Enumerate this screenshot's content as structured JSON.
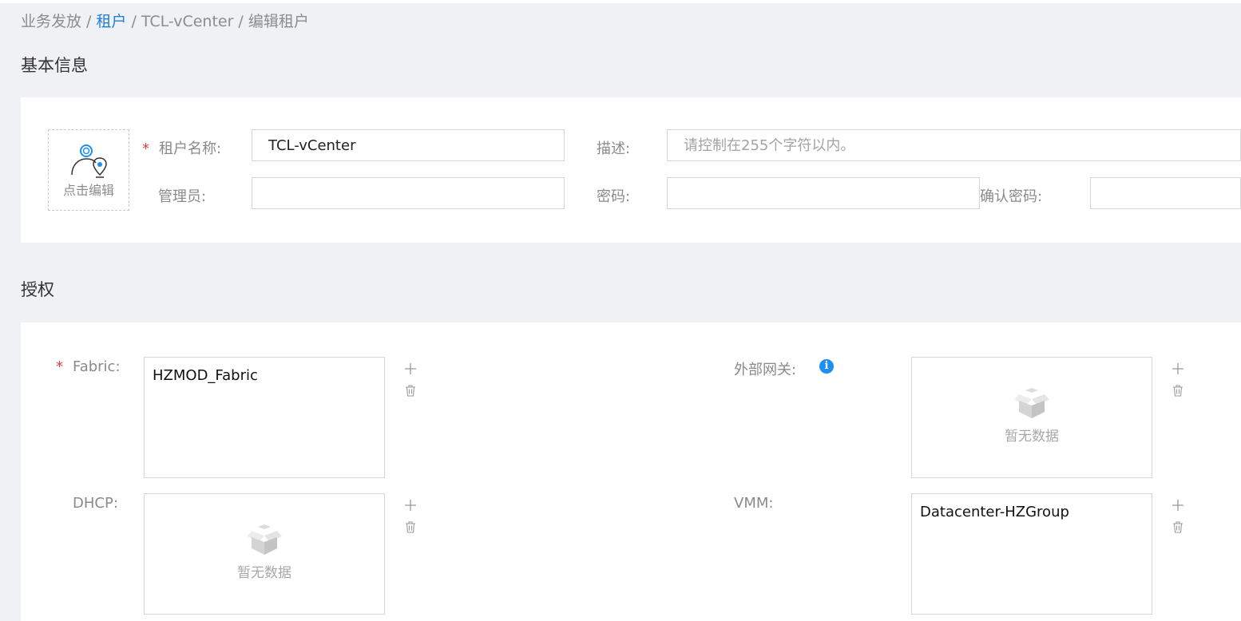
{
  "breadcrumb": {
    "items": [
      "业务发放",
      "租户",
      "TCL-vCenter",
      "编辑租户"
    ],
    "separator": "/"
  },
  "basic_info": {
    "title": "基本信息",
    "avatar_caption": "点击编辑",
    "tenant_name_label": "租户名称:",
    "tenant_name_value": "TCL-vCenter",
    "description_label": "描述:",
    "description_placeholder": "请控制在255个字符以内。",
    "admin_label": "管理员:",
    "admin_value": "",
    "password_label": "密码:",
    "password_value": "",
    "confirm_password_label": "确认密码:",
    "confirm_password_value": "",
    "required_mark": "*"
  },
  "authorization": {
    "title": "授权",
    "fabric": {
      "label": "Fabric:",
      "items": [
        "HZMOD_Fabric"
      ]
    },
    "external_gateway": {
      "label": "外部网关:",
      "empty_text": "暂无数据"
    },
    "dhcp": {
      "label": "DHCP:",
      "empty_text": "暂无数据"
    },
    "vmm": {
      "label": "VMM:",
      "items": [
        "Datacenter-HZGroup"
      ]
    }
  },
  "colors": {
    "page_bg": "#f0f1f4",
    "card_bg": "#ffffff",
    "link": "#1f7fd8",
    "required": "#e03c3c",
    "info": "#1f8ef1"
  },
  "icons": [
    "user-location-icon",
    "info-icon",
    "add-icon",
    "delete-icon",
    "empty-box-icon"
  ]
}
